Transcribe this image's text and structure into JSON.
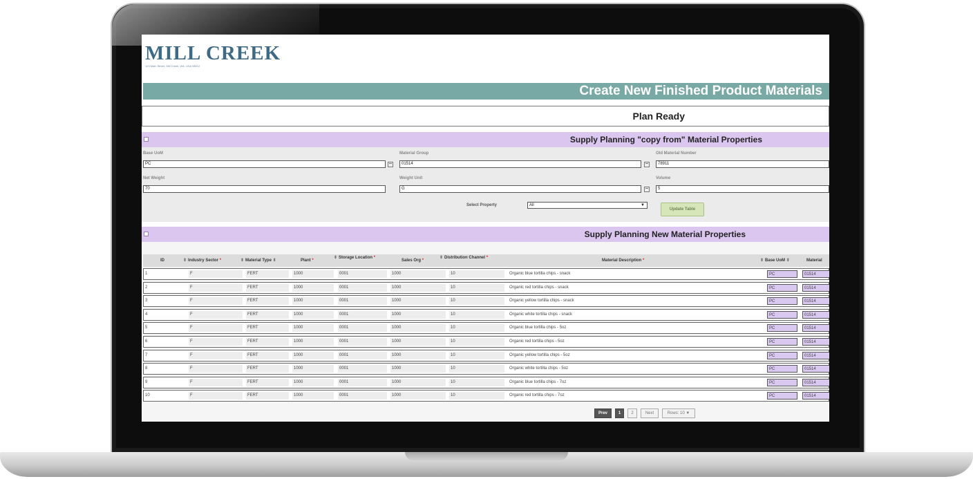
{
  "header": {
    "logo_text": "MILL CREEK",
    "logo_subtext": "123 Main Street, Mill Creek, WA, USA 98012",
    "page_title": "Create New Finished Product Materials",
    "status": "Plan Ready"
  },
  "copy_section": {
    "title": "Supply Planning \"copy from\" Material Properties",
    "fields": [
      {
        "label": "Base UoM",
        "value": "PC"
      },
      {
        "label": "Material Group",
        "value": "01514"
      },
      {
        "label": "Old Material Number",
        "value": "78911"
      },
      {
        "label": "Net Weight",
        "value": "70"
      },
      {
        "label": "Weight Unit",
        "value": "G"
      },
      {
        "label": "Volume",
        "value": "5"
      }
    ],
    "select_label": "Select Property",
    "select_value": "All",
    "update_label": "Update Table"
  },
  "new_section": {
    "title": "Supply Planning New Material Properties",
    "columns": [
      "ID",
      "Industry Sector",
      "Material Type",
      "Plant",
      "Storage Location",
      "Sales Org",
      "Distribution Channel",
      "Material Description",
      "Base UoM",
      "Material"
    ],
    "rows": [
      {
        "id": "1",
        "sector": "F",
        "type": "FERT",
        "plant": "1000",
        "storage": "0001",
        "sales": "1000",
        "channel": "10",
        "desc": "Organic blue tortilla chips - snack",
        "uom": "PC",
        "material": "01514"
      },
      {
        "id": "2",
        "sector": "F",
        "type": "FERT",
        "plant": "1000",
        "storage": "0001",
        "sales": "1000",
        "channel": "10",
        "desc": "Organic red tortilla chips - snack",
        "uom": "PC",
        "material": "01514"
      },
      {
        "id": "3",
        "sector": "F",
        "type": "FERT",
        "plant": "1000",
        "storage": "0001",
        "sales": "1000",
        "channel": "10",
        "desc": "Organic yellow tortilla chips - snack",
        "uom": "PC",
        "material": "01514"
      },
      {
        "id": "4",
        "sector": "F",
        "type": "FERT",
        "plant": "1000",
        "storage": "0001",
        "sales": "1000",
        "channel": "10",
        "desc": "Organic white tortilla chips - snack",
        "uom": "PC",
        "material": "01514"
      },
      {
        "id": "5",
        "sector": "F",
        "type": "FERT",
        "plant": "1000",
        "storage": "0001",
        "sales": "1000",
        "channel": "10",
        "desc": "Organic blue tortilla chips - 5oz",
        "uom": "PC",
        "material": "01514"
      },
      {
        "id": "6",
        "sector": "F",
        "type": "FERT",
        "plant": "1000",
        "storage": "0001",
        "sales": "1000",
        "channel": "10",
        "desc": "Organic red tortilla chips - 5oz",
        "uom": "PC",
        "material": "01514"
      },
      {
        "id": "7",
        "sector": "F",
        "type": "FERT",
        "plant": "1000",
        "storage": "0001",
        "sales": "1000",
        "channel": "10",
        "desc": "Organic yellow tortilla chips - 5oz",
        "uom": "PC",
        "material": "01514"
      },
      {
        "id": "8",
        "sector": "F",
        "type": "FERT",
        "plant": "1000",
        "storage": "0001",
        "sales": "1000",
        "channel": "10",
        "desc": "Organic white tortilla chips - 5oz",
        "uom": "PC",
        "material": "01514"
      },
      {
        "id": "9",
        "sector": "F",
        "type": "FERT",
        "plant": "1000",
        "storage": "0001",
        "sales": "1000",
        "channel": "10",
        "desc": "Organic blue tortilla chips - 7oz",
        "uom": "PC",
        "material": "01514"
      },
      {
        "id": "10",
        "sector": "F",
        "type": "FERT",
        "plant": "1000",
        "storage": "0001",
        "sales": "1000",
        "channel": "10",
        "desc": "Organic red tortilla chips - 7oz",
        "uom": "PC",
        "material": "01514"
      }
    ]
  },
  "pager": {
    "prev": "Prev",
    "page1": "1",
    "page2": "2",
    "next": "Next",
    "rows": "Rows: 10 ▼"
  }
}
